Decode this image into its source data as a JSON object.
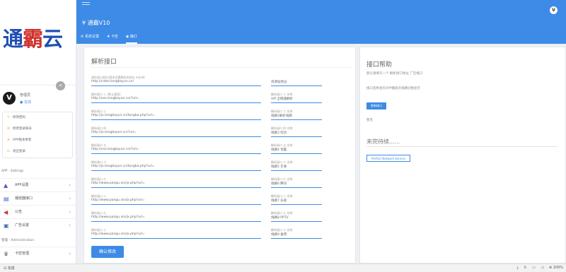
{
  "logo": {
    "part1": "通",
    "part2": "霸",
    "part3": "云"
  },
  "user": {
    "name": "管理员",
    "status": "● 在线",
    "avatar": "V"
  },
  "quick_menu": [
    {
      "icon": "✎",
      "label": "修改密码"
    },
    {
      "icon": "⚙",
      "label": "修改登录账号"
    },
    {
      "icon": "➤",
      "label": "APP版本更新"
    },
    {
      "icon": "⏻",
      "label": "退出登录"
    }
  ],
  "settings_section": "APP · Settings",
  "nav_settings": [
    {
      "icon": "▲",
      "label": "APP设置",
      "color": "#7b4bb5"
    },
    {
      "icon": "▤",
      "label": "播放器接口",
      "color": "#4466cc"
    },
    {
      "icon": "◀",
      "label": "公告",
      "color": "#d0312d"
    },
    {
      "icon": "▣",
      "label": "广告设置",
      "color": "#3a6fb0"
    }
  ],
  "admin_section": "管理 · Administration",
  "nav_admin": [
    {
      "icon": "♛",
      "label": "卡密管理",
      "color": "#666666"
    }
  ],
  "header": {
    "app_title": "¥ 通霸V10",
    "avatar": "V",
    "tabs": [
      {
        "label": "⚙ 系统设置",
        "active": false
      },
      {
        "label": "✚ 卡密",
        "active": false
      },
      {
        "label": "◉ 接口",
        "active": true
      }
    ]
  },
  "parse_card": {
    "title": "解析接口",
    "url_fields": [
      {
        "label": "请先接口地址(要求设置解析的地址 m3u8)",
        "value": "http://video.tongbayun.cn/"
      },
      {
        "label": "解析接口 三 (默认通用)",
        "value": "http://xxx.tongbayun.cn/?url="
      },
      {
        "label": "解析接口 二",
        "value": "http://jx.tongbayun.cn/tongba.php?url="
      },
      {
        "label": "解析接口 四",
        "value": "http://jx.tongbayun.cn/?url="
      },
      {
        "label": "解析接口 五",
        "value": "http://xxx.tongbayun.cn/?url="
      },
      {
        "label": "解析接口 六",
        "value": "http://jx.tongbayun.cn/tongba.php?url="
      },
      {
        "label": "解析接口 七",
        "value": "http://www.pangu.xin/jx.php?url="
      },
      {
        "label": "解析接口 八",
        "value": "http://www.pangu.xin/jx.php?url="
      },
      {
        "label": "解析接口 九",
        "value": "http://www.pangu.xin/jx.php?url="
      },
      {
        "label": "解析接口 十",
        "value": "http://www.pangu.xin/jx.php?url="
      }
    ],
    "name_fields": [
      {
        "label": "",
        "value": "资源站地址"
      },
      {
        "label": "解析接口 三 名称",
        "value": "VIP 全网通解析"
      },
      {
        "label": "解析接口 二 名称",
        "value": "线路2解析线路"
      },
      {
        "label": "解析接口 四 名称",
        "value": "线路3 综合"
      },
      {
        "label": "解析接口 五 名称",
        "value": "线路4 优酷"
      },
      {
        "label": "解析接口 六 名称",
        "value": "线路5 芒果"
      },
      {
        "label": "解析接口 七 名称",
        "value": "线路6 腾讯"
      },
      {
        "label": "解析接口 八 名称",
        "value": "线路7 乐视"
      },
      {
        "label": "解析接口 九 名称",
        "value": "线路8 PPTV"
      },
      {
        "label": "解析接口 十 名称",
        "value": "线路9 备用"
      }
    ],
    "confirm_label": "确认修改"
  },
  "help_card": {
    "title": "接口帮助",
    "line1": "默认请填写一个 解析接口地址 广告接口",
    "line2": "接口名称会在APP播放页线路切换显示",
    "button_label": "更新接口",
    "line3": "暂无",
    "subtitle": "未完待续......",
    "badge": "Perfect Network Service"
  },
  "statusbar": {
    "status": "完成",
    "zoom": "100%"
  }
}
